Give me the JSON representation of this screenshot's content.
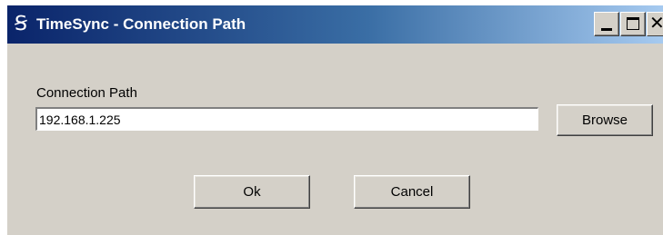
{
  "window": {
    "icon_glyph": "Ꞩ",
    "icon_name": "timesync-app-icon",
    "title": "TimeSync - Connection Path"
  },
  "caption_buttons": {
    "minimize_icon": "minimize-icon",
    "maximize_icon": "maximize-icon",
    "close_glyph": "✕",
    "close_icon": "close-icon"
  },
  "form": {
    "label": "Connection Path",
    "path_value": "192.168.1.225",
    "browse_label": "Browse"
  },
  "actions": {
    "ok_label": "Ok",
    "cancel_label": "Cancel"
  },
  "colors": {
    "dialog_bg": "#d4d0c8",
    "titlebar_start": "#0a246a",
    "titlebar_end": "#a6caf0",
    "title_text": "#ffffff"
  }
}
